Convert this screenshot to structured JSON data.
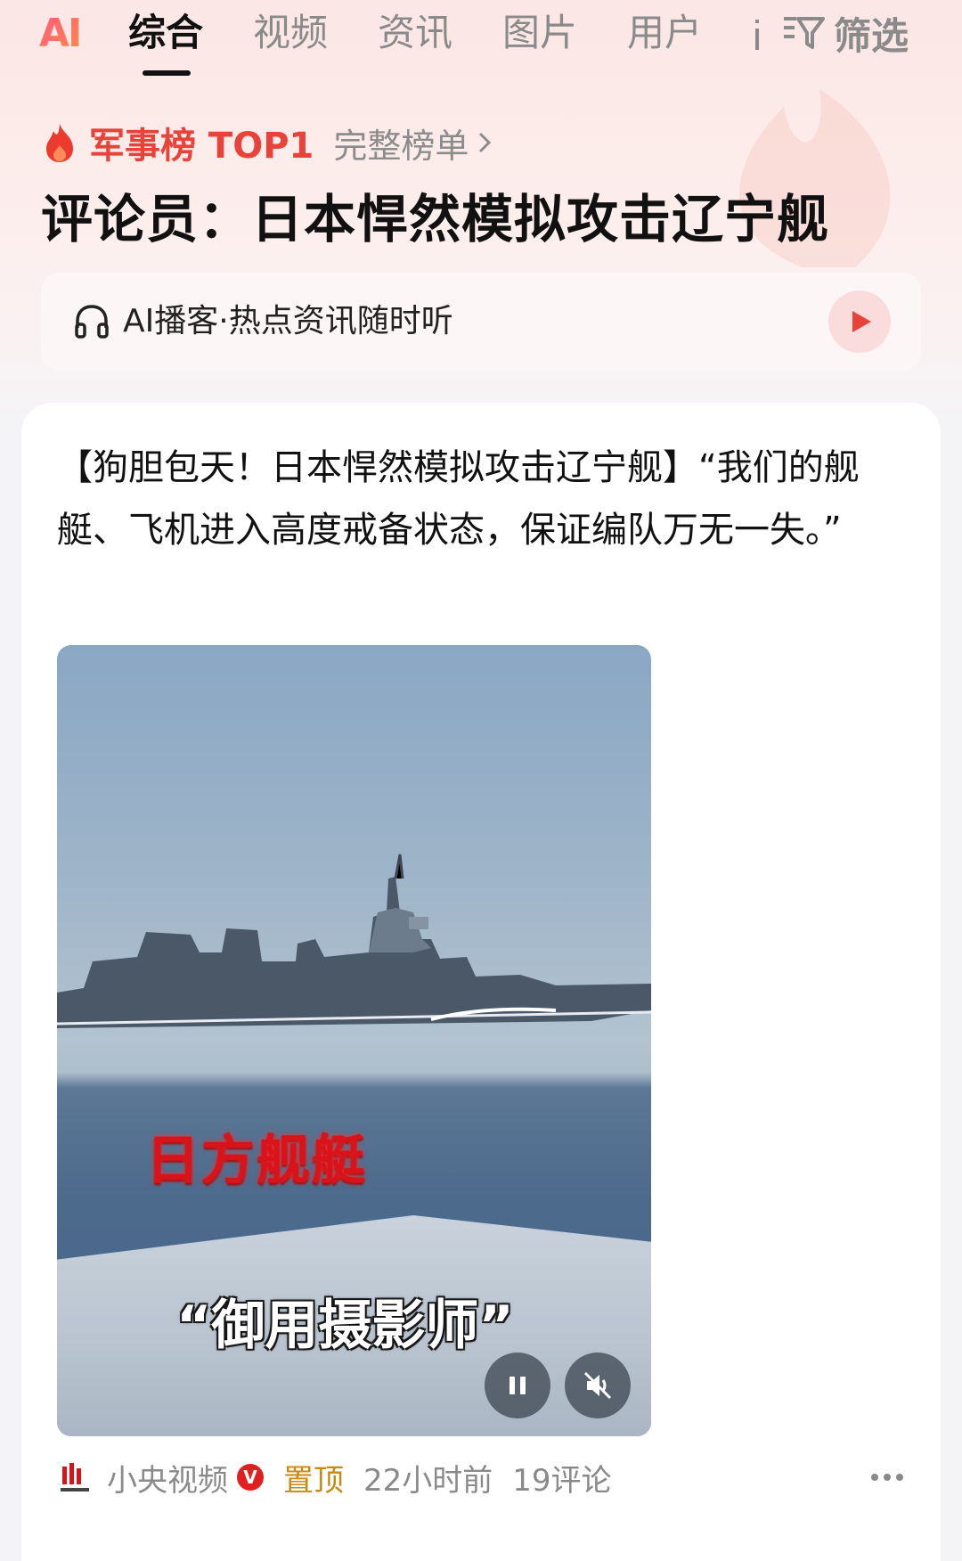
{
  "tabs": {
    "ai": "AI",
    "items": [
      "综合",
      "视频",
      "资讯",
      "图片",
      "用户"
    ],
    "active_index": 0,
    "filter": "筛选"
  },
  "ranking": {
    "title": "军事榜 TOP1",
    "full_list": "完整榜单"
  },
  "headline": "评论员：日本悍然模拟攻击辽宁舰",
  "podcast": {
    "text": "AI播客·热点资讯随时听"
  },
  "post": {
    "text": "【狗胆包天！日本悍然模拟攻击辽宁舰】“我们的舰艇、飞机进入高度戒备状态，保证编队万无一失。”",
    "video": {
      "overlay_red": "日方舰艇",
      "overlay_white": "“御用摄影师”",
      "state": "playing",
      "muted": true
    },
    "source": "小央视频",
    "verified_badge": "V",
    "pinned": "置顶",
    "time": "22小时前",
    "comments": "19评论"
  },
  "colors": {
    "accent_red": "#e8423a",
    "pinned_gold": "#c88a10"
  }
}
